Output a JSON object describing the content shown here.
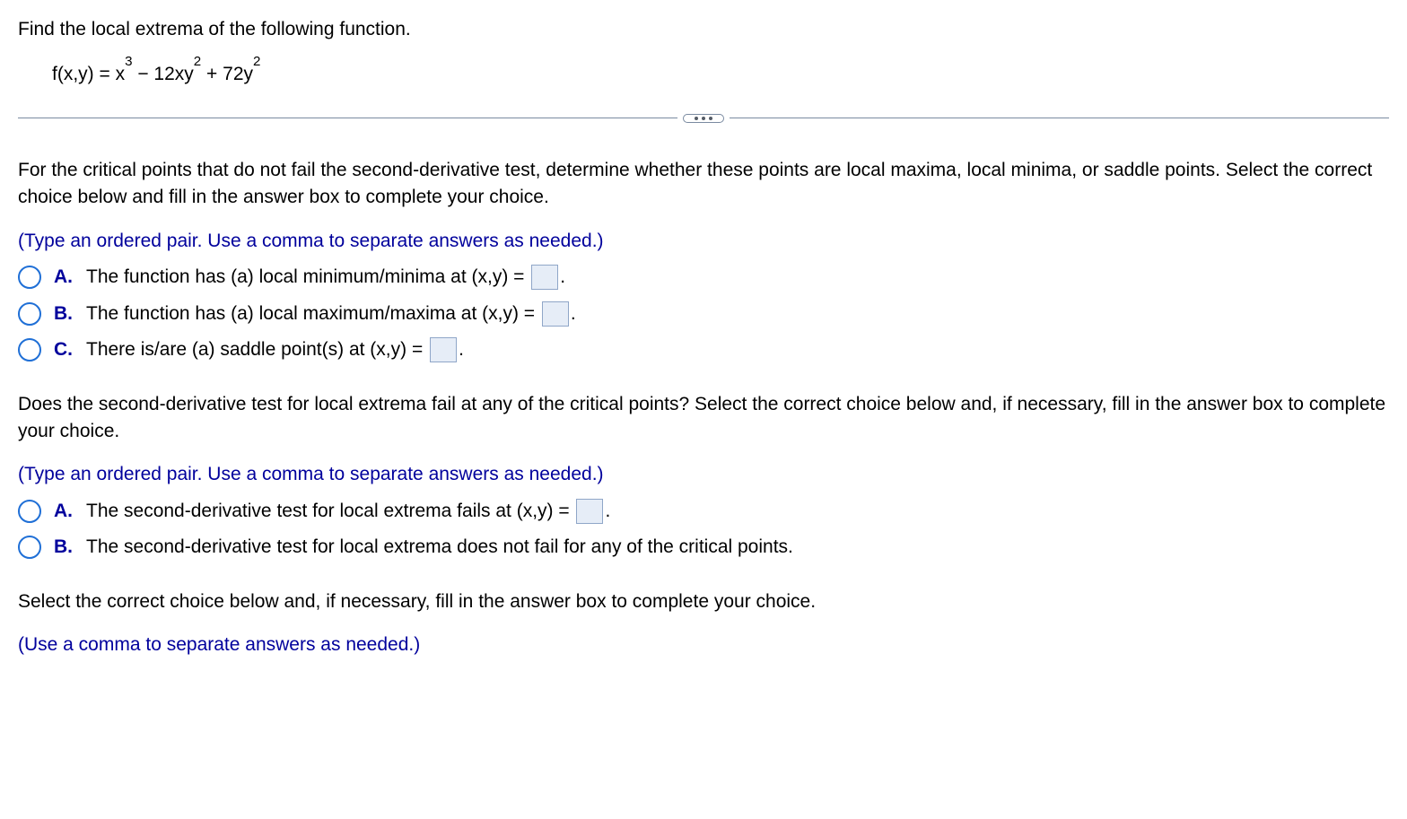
{
  "prompt": "Find the local extrema of the following function.",
  "equation": {
    "lhs": "f(x,y) = x",
    "exp1": "3",
    "mid1": " − 12xy",
    "exp2": "2",
    "mid2": " + 72y",
    "exp3": "2"
  },
  "part1": {
    "text": "For the critical points that do not fail the second-derivative test, determine whether these points are local maxima, local minima, or saddle points. Select the correct choice below and fill in the answer box to complete your choice.",
    "hint": "(Type an ordered pair. Use a comma to separate answers as needed.)",
    "options": {
      "A": {
        "label": "A.",
        "text": "The function has (a) local minimum/minima at (x,y) =",
        "period": "."
      },
      "B": {
        "label": "B.",
        "text": "The function has (a) local maximum/maxima at (x,y) =",
        "period": "."
      },
      "C": {
        "label": "C.",
        "text": "There is/are (a) saddle point(s) at (x,y) =",
        "period": "."
      }
    }
  },
  "part2": {
    "text": "Does the second-derivative test for local extrema fail at any of the critical points? Select the correct choice below and, if necessary, fill in the answer box to complete your choice.",
    "hint": "(Type an ordered pair. Use a comma to separate answers as needed.)",
    "options": {
      "A": {
        "label": "A.",
        "text": "The second-derivative test for local extrema fails at (x,y) =",
        "period": "."
      },
      "B": {
        "label": "B.",
        "text": "The second-derivative test for local extrema does not fail for any of the critical points."
      }
    }
  },
  "part3": {
    "text": "Select the correct choice below and, if necessary, fill in the answer box to complete your choice.",
    "hint": "(Use a comma to separate answers as needed.)"
  }
}
